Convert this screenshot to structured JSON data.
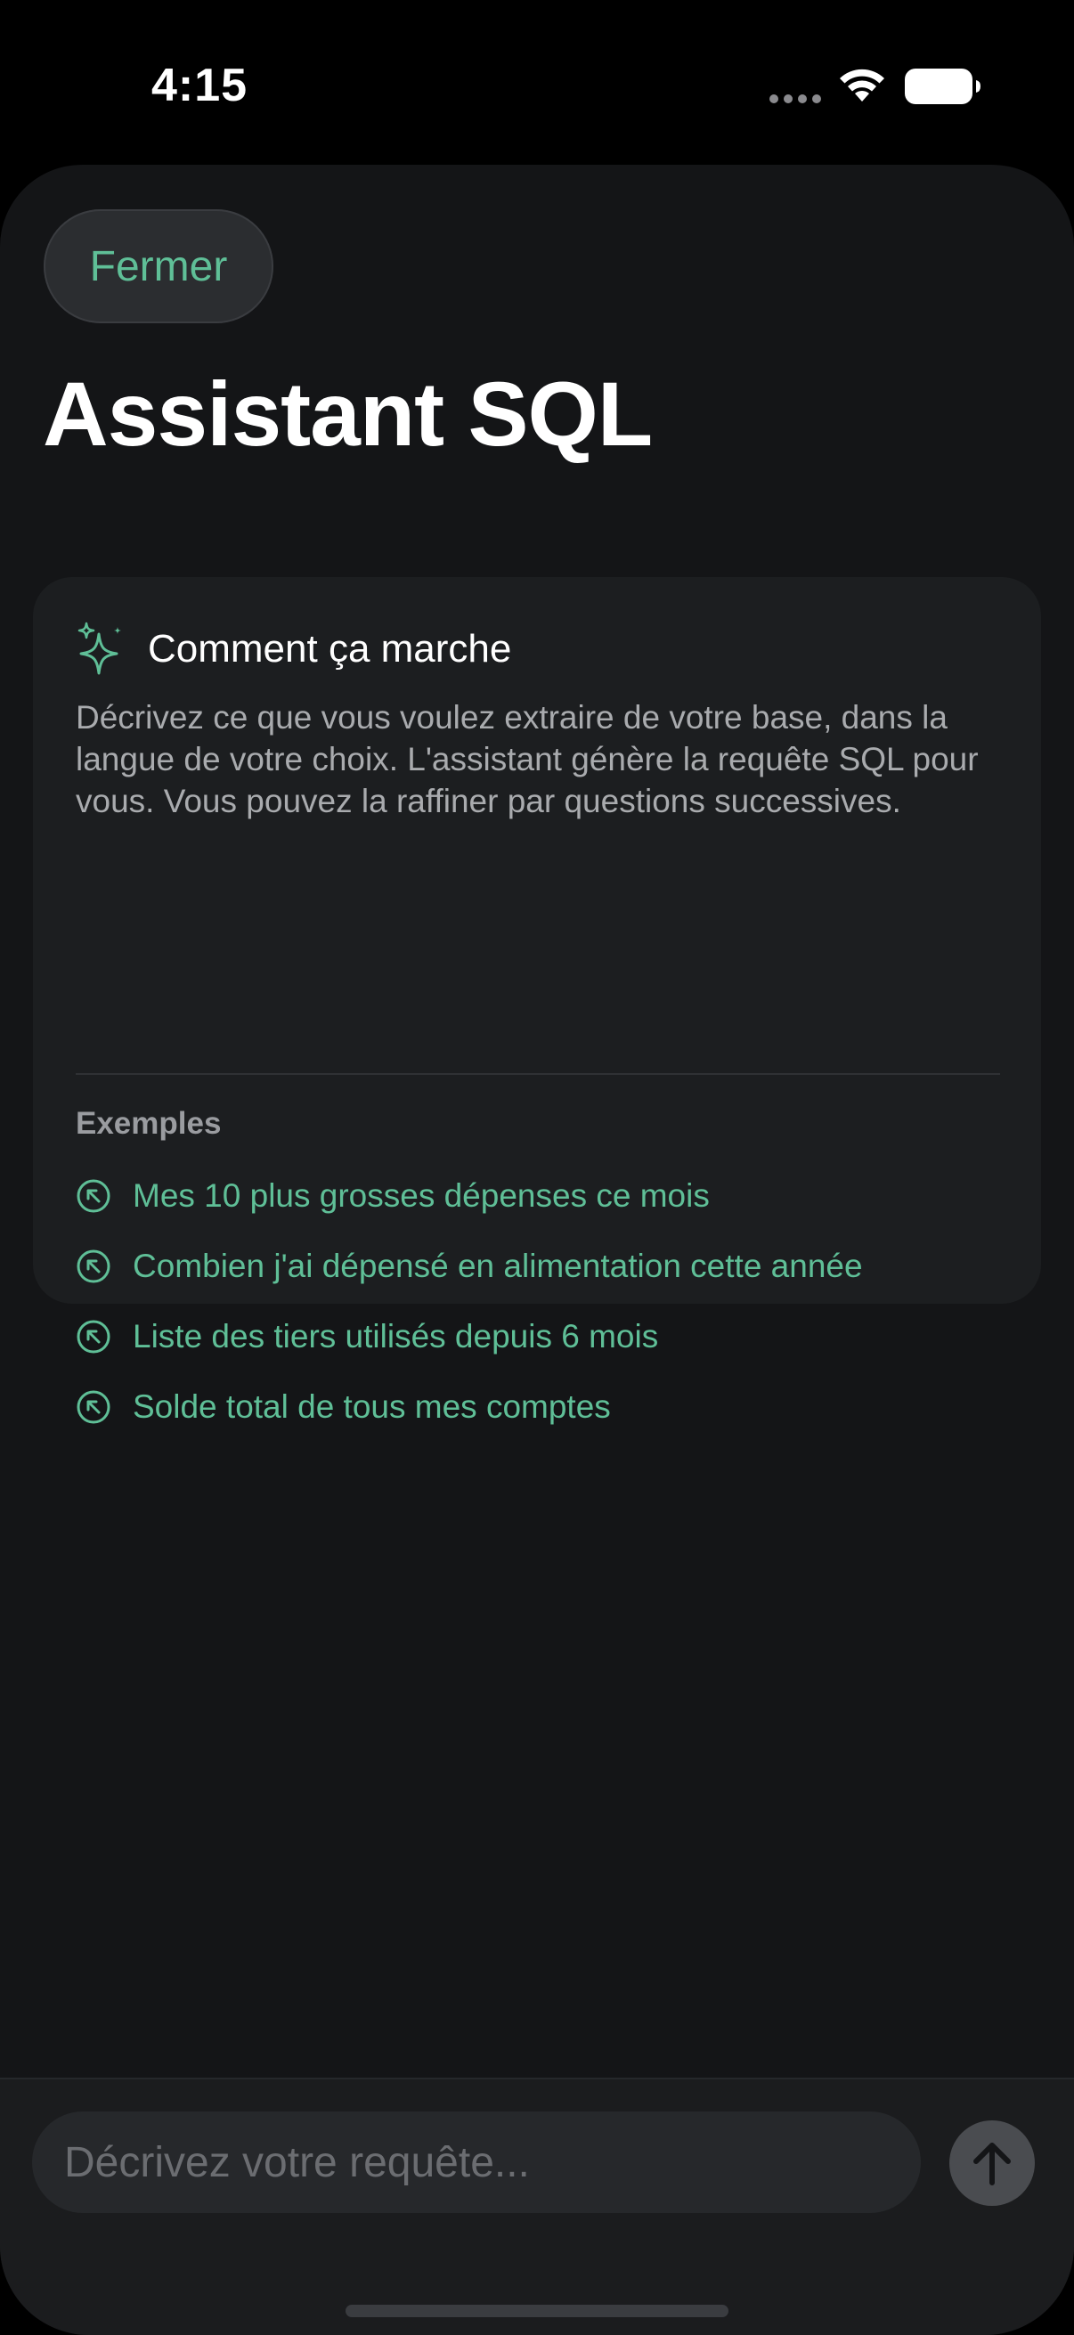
{
  "status_bar": {
    "time": "4:15",
    "icons": [
      "signal-dots-icon",
      "wifi-icon",
      "battery-icon"
    ]
  },
  "header": {
    "close_label": "Fermer",
    "title": "Assistant SQL"
  },
  "info_card": {
    "icon": "sparkle-icon",
    "title": "Comment ça marche",
    "description": "Décrivez ce que vous voulez extraire de votre base, dans la langue de votre choix. L'assistant génère la requête SQL pour vous. Vous pouvez la raffiner par questions successives.",
    "examples_label": "Exemples",
    "examples": [
      {
        "icon": "arrow-up-left-circle-icon",
        "label": "Mes 10 plus grosses dépenses ce mois"
      },
      {
        "icon": "arrow-up-left-circle-icon",
        "label": "Combien j'ai dépensé en alimentation cette année"
      },
      {
        "icon": "arrow-up-left-circle-icon",
        "label": "Liste des tiers utilisés depuis 6 mois"
      },
      {
        "icon": "arrow-up-left-circle-icon",
        "label": "Solde total de tous mes comptes"
      }
    ]
  },
  "composer": {
    "value": "",
    "placeholder": "Décrivez votre requête...",
    "send_icon": "arrow-up-icon"
  },
  "colors": {
    "accent": "#5fbf97",
    "background": "#141517",
    "card": "#1c1e20",
    "secondary_text": "#a9abae"
  }
}
